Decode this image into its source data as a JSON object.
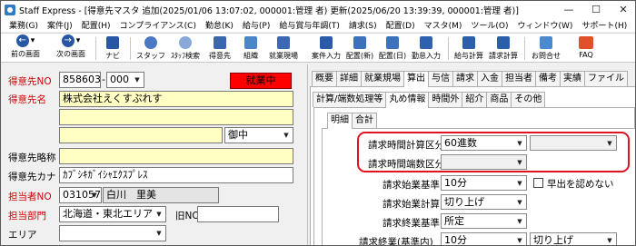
{
  "window": {
    "title": "Staff Express - [得意先マスタ  追加(2025/01/06 13:07:02, 000001:管理  者)  更新(2025/06/20 13:39:39, 000001:管理  者)]",
    "minimize": "—",
    "maximize": "☐",
    "close": "✕"
  },
  "menu": [
    "業務(G)",
    "案件(J)",
    "配置(H)",
    "コンプライアンス(C)",
    "勤怠(K)",
    "給与(P)",
    "給与賞与年調(T)",
    "請求(S)",
    "配置(D)",
    "マスタ(M)",
    "ツール(O)",
    "ウィンドウ(W)",
    "サポート(H)"
  ],
  "toolbar": {
    "prev_screen": "前の画面",
    "next_screen": "次の画面",
    "navi": "ナビ",
    "staff": "スタッフ",
    "staff_search": "ｽﾀｯﾌ検索",
    "client": "得意先",
    "organization": "組織",
    "assignment_site": "就業現場",
    "case_entry": "案件入力",
    "placement_new": "配置(新)",
    "placement_day": "配置(日)",
    "attendance_entry": "勤怠入力",
    "payroll_calc": "給与計算",
    "billing_calc": "請求計算",
    "inquiry": "お問合せ",
    "faq": "FAQ"
  },
  "left_form": {
    "client_no_label": "得意先NO",
    "client_no": "858603",
    "branch_no": "000",
    "status_badge": "就業中",
    "client_name_label": "得意先名",
    "client_name": "株式会社えくすぷれす",
    "client_name_2": "",
    "client_name_3": "",
    "honorific": "御中",
    "short_name_label": "得意先略称",
    "short_name": "",
    "kana_label": "得意先カナ",
    "kana": "ｶﾌﾞｼｷｶﾞｲｼｬｴｸｽﾌﾟﾚｽ",
    "staff_no_label": "担当者NO",
    "staff_no": "031057",
    "staff_name": "白川　里美",
    "dept_label": "担当部門",
    "dept": "北海道・東北エリア",
    "old_no_label": "旧NO",
    "old_no": "",
    "area_label": "エリア",
    "area": ""
  },
  "right_panel": {
    "tabs_row1": [
      "概要",
      "詳細",
      "就業規場",
      "算出",
      "与信",
      "請求",
      "入金",
      "担当者",
      "備考",
      "実績",
      "ファイル"
    ],
    "active_tab_row1": "算出",
    "tabs_row2": [
      "計算/端数処理等",
      "丸め情報",
      "時間外",
      "紹介",
      "商品",
      "その他"
    ],
    "active_tab_row2": "丸め情報",
    "tabs_row3": [
      "明細",
      "合計"
    ],
    "active_tab_row3": "明細",
    "fields": {
      "time_calc_unit_label": "請求時間計算区分",
      "time_calc_unit": "60進数",
      "time_calc_unit_extra": "",
      "time_rounding_label": "請求時間端数区分",
      "time_rounding": "",
      "start_std_label": "請求始業基準",
      "start_std": "10分",
      "early_label": "早出を認めない",
      "start_calc_label": "請求始業計算",
      "start_calc": "切り上げ",
      "end_std_label": "請求終業基準",
      "end_std": "所定",
      "end_internal_label": "請求終業(基準内)",
      "end_internal": "10分",
      "end_internal_calc": "切り上げ"
    }
  }
}
